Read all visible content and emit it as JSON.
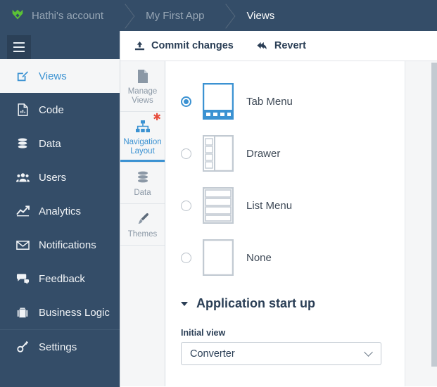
{
  "breadcrumb": {
    "logo_icon": "appgyver-diamond-logo",
    "items": [
      {
        "label": "Hathi's account",
        "current": false
      },
      {
        "label": "My First App",
        "current": false
      },
      {
        "label": "Views",
        "current": true
      }
    ]
  },
  "sidebar": {
    "menu_toggle_icon": "hamburger-icon",
    "items": [
      {
        "label": "Views",
        "icon": "edit-square-icon",
        "active": true
      },
      {
        "label": "Code",
        "icon": "code-file-icon",
        "active": false
      },
      {
        "label": "Data",
        "icon": "database-icon",
        "active": false
      },
      {
        "label": "Users",
        "icon": "users-icon",
        "active": false
      },
      {
        "label": "Analytics",
        "icon": "chart-line-icon",
        "active": false
      },
      {
        "label": "Notifications",
        "icon": "envelope-icon",
        "active": false
      },
      {
        "label": "Feedback",
        "icon": "comments-icon",
        "active": false
      },
      {
        "label": "Business Logic",
        "icon": "briefcase-icon",
        "active": false
      },
      {
        "label": "Settings",
        "icon": "wrench-key-icon",
        "active": false
      }
    ]
  },
  "toolbar": {
    "commit_label": "Commit changes",
    "commit_icon": "upload-icon",
    "revert_label": "Revert",
    "revert_icon": "undo-arrow-icon"
  },
  "tabs": [
    {
      "label": "Manage Views",
      "icon": "page-icon",
      "selected": false,
      "modified": false
    },
    {
      "label": "Navigation Layout",
      "icon": "sitemap-icon",
      "selected": true,
      "modified": true
    },
    {
      "label": "Data",
      "icon": "database-icon",
      "selected": false,
      "modified": false
    },
    {
      "label": "Themes",
      "icon": "paintbrush-icon",
      "selected": false,
      "modified": false
    }
  ],
  "navigation_layout": {
    "options": [
      {
        "label": "Tab Menu",
        "thumb": "tab-menu-thumb",
        "selected": true
      },
      {
        "label": "Drawer",
        "thumb": "drawer-thumb",
        "selected": false
      },
      {
        "label": "List Menu",
        "thumb": "list-menu-thumb",
        "selected": false
      },
      {
        "label": "None",
        "thumb": "none-thumb",
        "selected": false
      }
    ]
  },
  "startup_section": {
    "title": "Application start up",
    "expanded": true,
    "caret_icon": "caret-down-icon",
    "initial_view_label": "Initial view",
    "initial_view_value": "Converter",
    "initial_view_chevron_icon": "chevron-down-icon"
  },
  "colors": {
    "header_bg": "#344d68",
    "accent_blue": "#3b92d2",
    "panel_bg": "#f5f6f7",
    "text_dark": "#2b3f56",
    "modified_marker": "#e74c3c",
    "logo_green": "#5bc236"
  },
  "scrollbar": {
    "name": "panel-vertical-scrollbar"
  }
}
